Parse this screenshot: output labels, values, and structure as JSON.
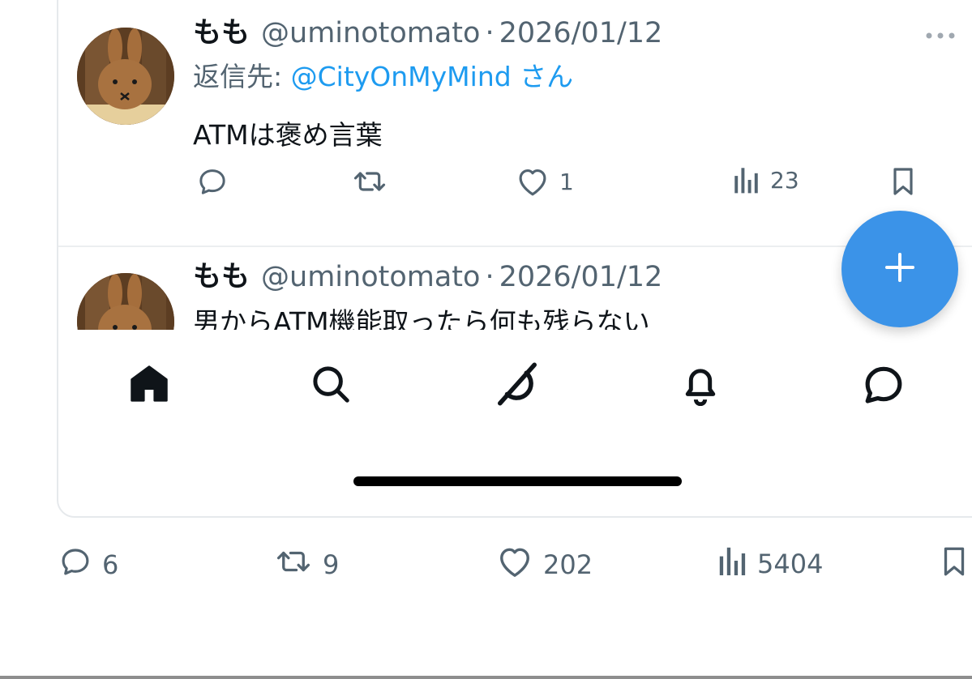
{
  "posts": [
    {
      "display_name": "もも",
      "handle": "@uminotomato",
      "separator": "·",
      "date": "2026/01/12",
      "reply_prefix": "返信先: ",
      "reply_to": "@CityOnMyMind",
      "reply_suffix": " さん",
      "text": "ATMは褒め言葉",
      "likes": "1",
      "views": "23"
    },
    {
      "display_name": "もも",
      "handle": "@uminotomato",
      "separator": "·",
      "date": "2026/01/12",
      "text": "男からATM機能取ったら何も残らない"
    }
  ],
  "fab_icon": "plus-icon",
  "nav_items": [
    "home-icon",
    "search-icon",
    "grok-icon",
    "bell-icon",
    "messages-icon"
  ],
  "main_post_stats": {
    "replies": "6",
    "reposts": "9",
    "likes": "202",
    "views": "5404"
  },
  "colors": {
    "accent": "#1d9bf0",
    "fab": "#3b93e8",
    "muted": "#536471"
  }
}
